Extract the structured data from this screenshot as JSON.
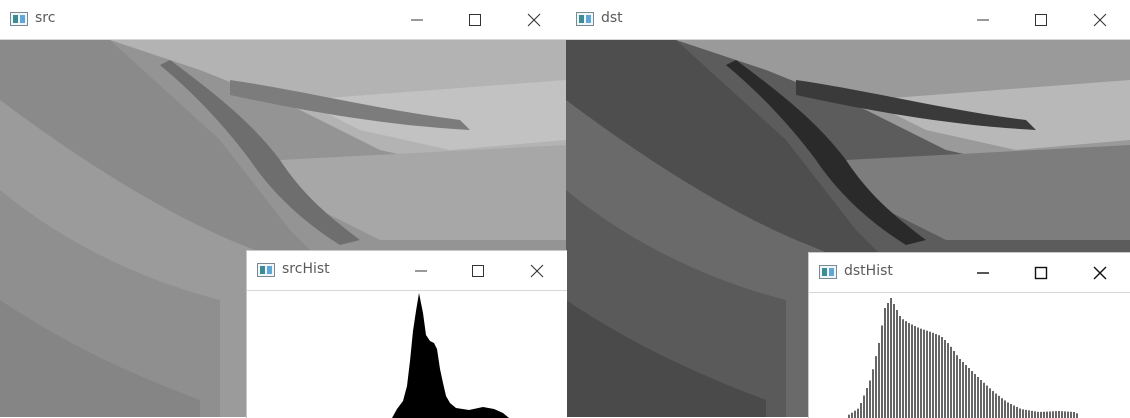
{
  "windows": {
    "src": {
      "title": "src"
    },
    "dst": {
      "title": "dst"
    },
    "srcHist": {
      "title": "srcHist"
    },
    "dstHist": {
      "title": "dstHist"
    }
  },
  "icons": {
    "app": "opencv-window-icon",
    "minimize": "minimize-icon",
    "maximize": "maximize-icon",
    "close": "close-icon"
  },
  "colors": {
    "titlebar": "#ffffff",
    "title_text": "#5a5a5a",
    "hist_fill": "#000000",
    "src_image_tone": "#8f8f8f",
    "dst_image_tone": "#5f5f5f"
  }
}
